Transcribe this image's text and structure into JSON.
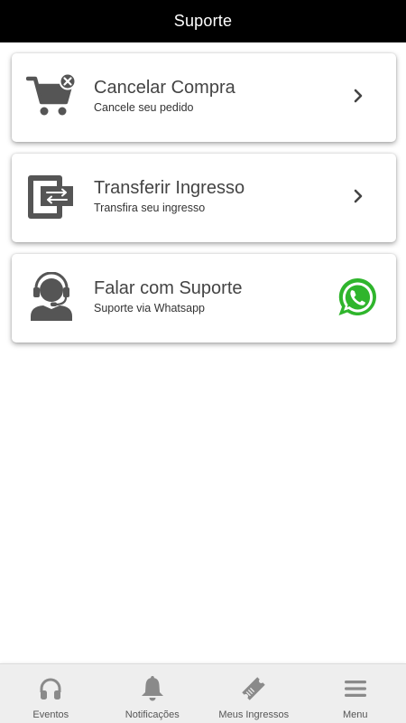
{
  "header": {
    "title": "Suporte"
  },
  "cards": [
    {
      "title": "Cancelar Compra",
      "subtitle": "Cancele seu pedido",
      "icon": "cart-cancel-icon",
      "action_icon": "chevron-right-icon"
    },
    {
      "title": "Transferir Ingresso",
      "subtitle": "Transfira seu ingresso",
      "icon": "transfer-icon",
      "action_icon": "chevron-right-icon"
    },
    {
      "title": "Falar com Suporte",
      "subtitle": "Suporte via Whatsapp",
      "icon": "support-agent-icon",
      "action_icon": "whatsapp-icon"
    }
  ],
  "bottom_nav": [
    {
      "label": "Eventos",
      "icon": "headphones-icon"
    },
    {
      "label": "Notificações",
      "icon": "bell-icon"
    },
    {
      "label": "Meus Ingressos",
      "icon": "ticket-icon"
    },
    {
      "label": "Menu",
      "icon": "menu-icon"
    }
  ],
  "colors": {
    "header_bg": "#000000",
    "icon_gray": "#555555",
    "nav_icon_gray": "#8a8a8a",
    "whatsapp_green": "#2fb52c"
  }
}
